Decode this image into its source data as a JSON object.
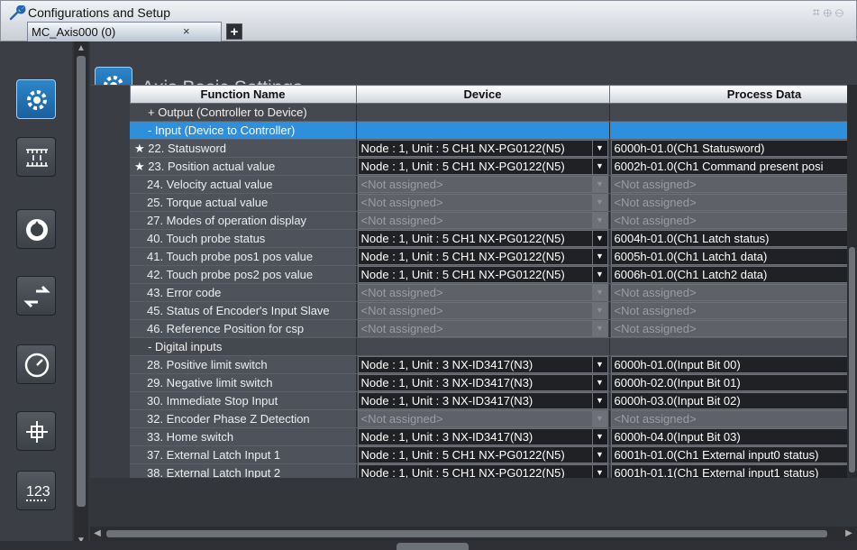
{
  "window": {
    "title": "Configurations and Setup",
    "tab_label": "MC_Axis000 (0)",
    "tab_close": "×",
    "add_tab": "+"
  },
  "header": {
    "title": "Axis Basic Settings"
  },
  "sidebar": {
    "buttons": [
      {
        "icon": "axis-settings-icon",
        "active": true
      },
      {
        "icon": "unit-conversion-icon",
        "active": false
      },
      {
        "icon": "operation-settings-icon",
        "active": false
      },
      {
        "icon": "direction-icon",
        "active": false
      },
      {
        "icon": "speedometer-icon",
        "active": false
      },
      {
        "icon": "position-crosshair-icon",
        "active": false
      },
      {
        "icon": "numeric-icon",
        "active": false
      }
    ]
  },
  "table": {
    "headers": {
      "function_name": "Function Name",
      "device": "Device",
      "process_data": "Process Data"
    },
    "rows": [
      {
        "group": true,
        "name": "+   Output (Controller to Device)",
        "device": "",
        "process": ""
      },
      {
        "group": true,
        "selected": true,
        "name": "-   Input (Device to Controller)",
        "device": "",
        "process": ""
      },
      {
        "star": "★",
        "name": "22. Statusword",
        "device": "Node : 1, Unit : 5 CH1 NX-PG0122(N5)",
        "process": "6000h-01.0(Ch1 Statusword)"
      },
      {
        "star": "★",
        "name": "23. Position actual value",
        "device": "Node : 1, Unit : 5 CH1 NX-PG0122(N5)",
        "process": "6002h-01.0(Ch1 Command present posi"
      },
      {
        "name": "24. Velocity actual value",
        "device": "<Not assigned>",
        "process": "<Not assigned>",
        "na": true
      },
      {
        "name": "25. Torque actual value",
        "device": "<Not assigned>",
        "process": "<Not assigned>",
        "na": true
      },
      {
        "name": "27. Modes of operation display",
        "device": "<Not assigned>",
        "process": "<Not assigned>",
        "na": true
      },
      {
        "name": "40. Touch probe status",
        "device": "Node : 1, Unit : 5 CH1 NX-PG0122(N5)",
        "process": "6004h-01.0(Ch1 Latch status)"
      },
      {
        "name": "41. Touch probe pos1 pos value",
        "device": "Node : 1, Unit : 5 CH1 NX-PG0122(N5)",
        "process": "6005h-01.0(Ch1 Latch1 data)"
      },
      {
        "name": "42. Touch probe pos2 pos value",
        "device": "Node : 1, Unit : 5 CH1 NX-PG0122(N5)",
        "process": "6006h-01.0(Ch1 Latch2 data)"
      },
      {
        "name": "43. Error code",
        "device": "<Not assigned>",
        "process": "<Not assigned>",
        "na": true
      },
      {
        "name": "45. Status of Encoder's Input Slave",
        "device": "<Not assigned>",
        "process": "<Not assigned>",
        "na": true
      },
      {
        "name": "46. Reference Position for csp",
        "device": "<Not assigned>",
        "process": "<Not assigned>",
        "na": true
      },
      {
        "group": true,
        "name": "-   Digital inputs",
        "device": "",
        "process": ""
      },
      {
        "name": "28. Positive limit switch",
        "device": "Node : 1, Unit : 3 NX-ID3417(N3)",
        "process": "6000h-01.0(Input Bit 00)"
      },
      {
        "name": "29. Negative limit switch",
        "device": "Node : 1, Unit : 3 NX-ID3417(N3)",
        "process": "6000h-02.0(Input Bit 01)"
      },
      {
        "name": "30. Immediate Stop Input",
        "device": "Node : 1, Unit : 3 NX-ID3417(N3)",
        "process": "6000h-03.0(Input Bit 02)"
      },
      {
        "name": "32. Encoder Phase Z Detection",
        "device": "<Not assigned>",
        "process": "<Not assigned>",
        "na": true
      },
      {
        "name": "33. Home switch",
        "device": "Node : 1, Unit : 3 NX-ID3417(N3)",
        "process": "6000h-04.0(Input Bit 03)"
      },
      {
        "name": "37. External Latch Input 1",
        "device": "Node : 1, Unit : 5 CH1 NX-PG0122(N5)",
        "process": "6001h-01.0(Ch1 External input0 status)"
      },
      {
        "name": "38. External Latch Input 2",
        "device": "Node : 1, Unit : 5 CH1 NX-PG0122(N5)",
        "process": "6001h-01.1(Ch1 External input1 status)"
      }
    ]
  },
  "colors": {
    "selection": "#2e8fdc",
    "accent": "#1b5f9c"
  }
}
